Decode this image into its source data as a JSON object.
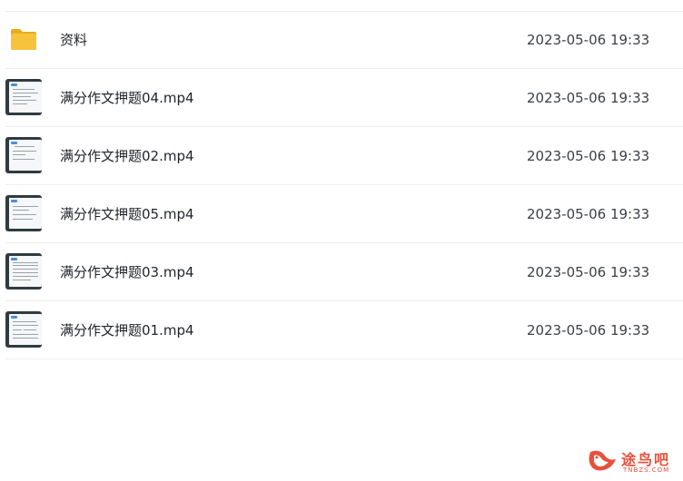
{
  "files": [
    {
      "name": "资料",
      "type": "folder",
      "icon": "folder-icon",
      "date": "2023-05-06 19:33"
    },
    {
      "name": "满分作文押题04.mp4",
      "type": "video",
      "icon": "video-thumbnail",
      "date": "2023-05-06 19:33"
    },
    {
      "name": "满分作文押题02.mp4",
      "type": "video",
      "icon": "video-thumbnail",
      "date": "2023-05-06 19:33"
    },
    {
      "name": "满分作文押题05.mp4",
      "type": "video",
      "icon": "video-thumbnail",
      "date": "2023-05-06 19:33"
    },
    {
      "name": "满分作文押题03.mp4",
      "type": "video",
      "icon": "video-thumbnail",
      "date": "2023-05-06 19:33"
    },
    {
      "name": "满分作文押题01.mp4",
      "type": "video",
      "icon": "video-thumbnail",
      "date": "2023-05-06 19:33"
    }
  ],
  "watermark": {
    "text": "途鸟吧",
    "sub": "TNBZS.COM",
    "color": "#e8503a"
  },
  "colors": {
    "folder": "#f7c33b",
    "folder_dark": "#e9ad1c",
    "divider": "#eceef1"
  }
}
